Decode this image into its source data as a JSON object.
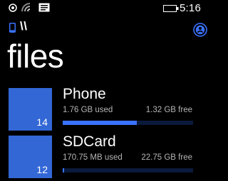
{
  "status_bar": {
    "time": "5:16",
    "icons": [
      "signal-icon",
      "wifi-icon",
      "message-icon",
      "battery-icon"
    ]
  },
  "header": {
    "location_icon": "phone-icon",
    "breadcrumb": "\\\\",
    "title": "files",
    "account_icon": "account-icon"
  },
  "storage": [
    {
      "name": "Phone",
      "count": "14",
      "used": "1.76 GB used",
      "free": "1.32 GB free",
      "used_fraction": 0.57
    },
    {
      "name": "SDCard",
      "count": "12",
      "used": "170.75 MB used",
      "free": "22.75 GB free",
      "used_fraction": 0.007
    }
  ],
  "colors": {
    "tile": "#3367d6",
    "bar_fill": "#3a72ff",
    "bar_track": "#0a1a3c",
    "background": "#000000"
  }
}
